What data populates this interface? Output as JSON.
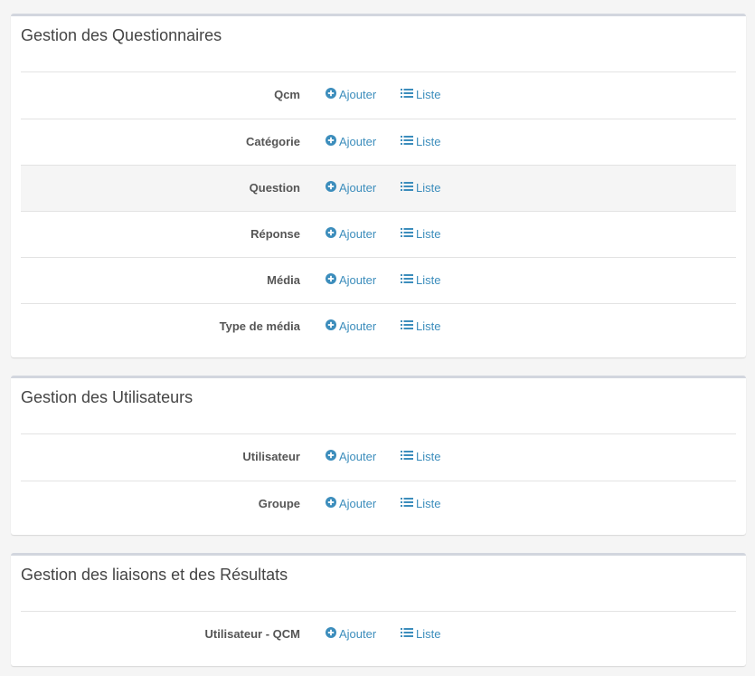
{
  "sections": [
    {
      "title": "Gestion des Questionnaires",
      "rows": [
        {
          "label": "Qcm",
          "add": "Ajouter",
          "list": "Liste"
        },
        {
          "label": "Catégorie",
          "add": "Ajouter",
          "list": "Liste"
        },
        {
          "label": "Question",
          "add": "Ajouter",
          "list": "Liste"
        },
        {
          "label": "Réponse",
          "add": "Ajouter",
          "list": "Liste"
        },
        {
          "label": "Média",
          "add": "Ajouter",
          "list": "Liste"
        },
        {
          "label": "Type de média",
          "add": "Ajouter",
          "list": "Liste"
        }
      ]
    },
    {
      "title": "Gestion des Utilisateurs",
      "rows": [
        {
          "label": "Utilisateur",
          "add": "Ajouter",
          "list": "Liste"
        },
        {
          "label": "Groupe",
          "add": "Ajouter",
          "list": "Liste"
        }
      ]
    },
    {
      "title": "Gestion des liaisons et des Résultats",
      "rows": [
        {
          "label": "Utilisateur - QCM",
          "add": "Ajouter",
          "list": "Liste"
        }
      ]
    }
  ],
  "highlighted_row": "Question",
  "icons": {
    "add": "plus-circle-icon",
    "list": "list-icon"
  },
  "colors": {
    "link": "#3c8dbc",
    "box_border": "#d2d6de",
    "background": "#f5f5f5",
    "row_hover": "#f5f5f5"
  }
}
